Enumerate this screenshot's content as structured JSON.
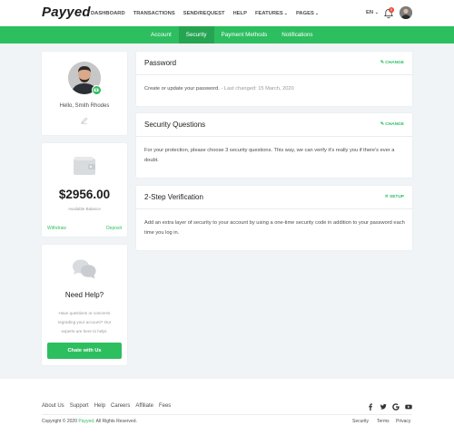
{
  "brand": {
    "logo": "Payyed",
    "accent": "#2dbe60"
  },
  "header": {
    "nav": [
      {
        "label": "DASHBOARD"
      },
      {
        "label": "TRANSACTIONS"
      },
      {
        "label": "SEND/REQUEST"
      },
      {
        "label": "HELP"
      },
      {
        "label": "FEATURES",
        "dropdown": true
      },
      {
        "label": "PAGES",
        "dropdown": true
      }
    ],
    "language": "EN",
    "notification_count": "5",
    "icons": {
      "bell": "bell-icon",
      "avatar": "user-avatar"
    }
  },
  "subnav": {
    "items": [
      "Account",
      "Security",
      "Payment Methods",
      "Notifications"
    ],
    "active": "Security"
  },
  "profile": {
    "greeting": "Hello, Smith Rhodes"
  },
  "balance": {
    "amount": "$2956.00",
    "label": "Available Balance",
    "withdraw": "Withdraw",
    "deposit": "Deposit"
  },
  "help": {
    "title": "Need Help?",
    "text": "Have questions or concerns regrading your account? Our experts are here to help!.",
    "button": "Chate with Us"
  },
  "security": {
    "password": {
      "title": "Password",
      "action": "CHANGE",
      "body": "Create or update your password.",
      "last_changed": "- Last changed: 15 March, 2020"
    },
    "questions": {
      "title": "Security Questions",
      "action": "CHANGE",
      "body": "For your protection, please choose 3 security questions. This way, we can verify it's really you if there's ever a doubt."
    },
    "two_step": {
      "title": "2-Step Verification",
      "action": "SETUP",
      "body": "Add an extra layer of security to your account by using a one-time security code in addition to your password each time you log in."
    }
  },
  "footer": {
    "links": [
      "About Us",
      "Support",
      "Help",
      "Careers",
      "Affiliate",
      "Fees"
    ],
    "social": [
      "facebook-icon",
      "twitter-icon",
      "google-icon",
      "youtube-icon"
    ],
    "copyright_prefix": "Copyright © 2020 ",
    "copyright_brand": "Payyed",
    "copyright_suffix": ". All Rights Reserved.",
    "legal": [
      "Security",
      "Terms",
      "Privacy"
    ]
  }
}
